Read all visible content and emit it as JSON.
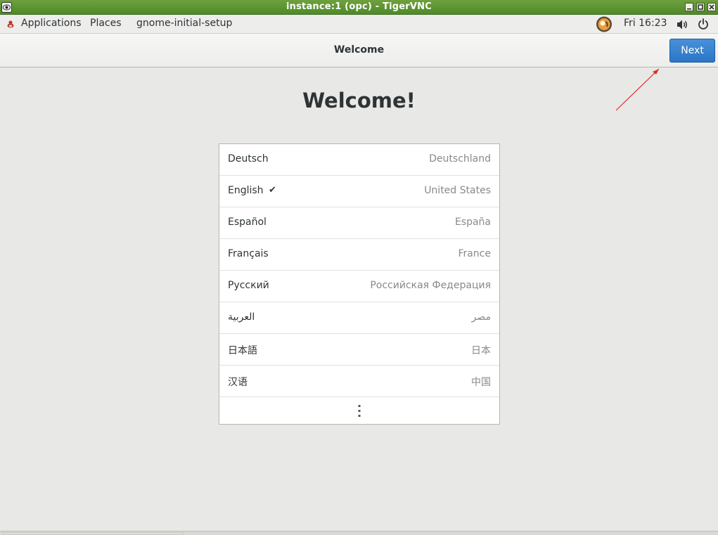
{
  "vnc_window": {
    "title": "instance:1 (opc) - TigerVNC",
    "logo_icon": "tigervnc-icon",
    "controls": [
      "minimize-icon",
      "maximize-icon",
      "close-icon"
    ]
  },
  "topbar": {
    "applications_label": "Applications",
    "places_label": "Places",
    "app_name": "gnome-initial-setup",
    "clock": "Fri 16:23",
    "icons": [
      "avatar-icon",
      "volume-icon",
      "power-icon"
    ]
  },
  "headerbar": {
    "title": "Welcome",
    "next_label": "Next",
    "next_color": "#2a76c6"
  },
  "main": {
    "heading": "Welcome!",
    "languages": [
      {
        "name": "Deutsch",
        "country": "Deutschland",
        "selected": false
      },
      {
        "name": "English",
        "country": "United States",
        "selected": true
      },
      {
        "name": "Español",
        "country": "España",
        "selected": false
      },
      {
        "name": "Français",
        "country": "France",
        "selected": false
      },
      {
        "name": "Русский",
        "country": "Российская Федерация",
        "selected": false
      },
      {
        "name": "العربية",
        "country": "مصر",
        "selected": false
      },
      {
        "name": "日本語",
        "country": "日本",
        "selected": false
      },
      {
        "name": "汉语",
        "country": "中国",
        "selected": false
      }
    ],
    "more_icon": "vertical-ellipsis-icon",
    "check_glyph": "✔"
  },
  "annotation": {
    "color": "#e0301e",
    "icon": "arrow-annotation"
  }
}
